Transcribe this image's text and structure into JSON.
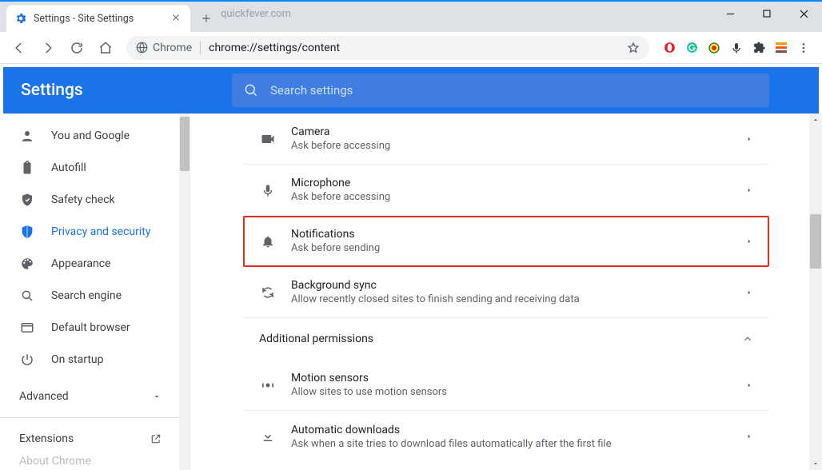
{
  "window": {
    "tab_title": "Settings - Site Settings",
    "ghost_url": "quickfever.com"
  },
  "omnibox": {
    "chip_label": "Chrome",
    "url": "chrome://settings/content"
  },
  "header": {
    "title": "Settings",
    "search_placeholder": "Search settings"
  },
  "sidebar": {
    "items": [
      {
        "key": "you",
        "label": "You and Google",
        "icon": "person"
      },
      {
        "key": "autofill",
        "label": "Autofill",
        "icon": "clipboard"
      },
      {
        "key": "safety",
        "label": "Safety check",
        "icon": "shield-check"
      },
      {
        "key": "privacy",
        "label": "Privacy and security",
        "icon": "shield",
        "active": true
      },
      {
        "key": "appearance",
        "label": "Appearance",
        "icon": "palette"
      },
      {
        "key": "search",
        "label": "Search engine",
        "icon": "magnify"
      },
      {
        "key": "default",
        "label": "Default browser",
        "icon": "browser"
      },
      {
        "key": "startup",
        "label": "On startup",
        "icon": "power"
      }
    ],
    "advanced_label": "Advanced",
    "extensions_label": "Extensions",
    "about_label": "About Chrome"
  },
  "permissions": {
    "rows": [
      {
        "key": "camera",
        "title": "Camera",
        "sub": "Ask before accessing",
        "icon": "camera"
      },
      {
        "key": "microphone",
        "title": "Microphone",
        "sub": "Ask before accessing",
        "icon": "mic"
      },
      {
        "key": "notifications",
        "title": "Notifications",
        "sub": "Ask before sending",
        "icon": "bell",
        "highlight": true
      },
      {
        "key": "bgsync",
        "title": "Background sync",
        "sub": "Allow recently closed sites to finish sending and receiving data",
        "icon": "sync"
      }
    ],
    "section_title": "Additional permissions",
    "extra_rows": [
      {
        "key": "motion",
        "title": "Motion sensors",
        "sub": "Allow sites to use motion sensors",
        "icon": "motion"
      },
      {
        "key": "autodl",
        "title": "Automatic downloads",
        "sub": "Ask when a site tries to download files automatically after the first file",
        "icon": "download"
      }
    ]
  },
  "ext_icons": [
    "opera-red",
    "grammarly-green",
    "idm",
    "mic",
    "puzzle",
    "unknown-orange"
  ]
}
